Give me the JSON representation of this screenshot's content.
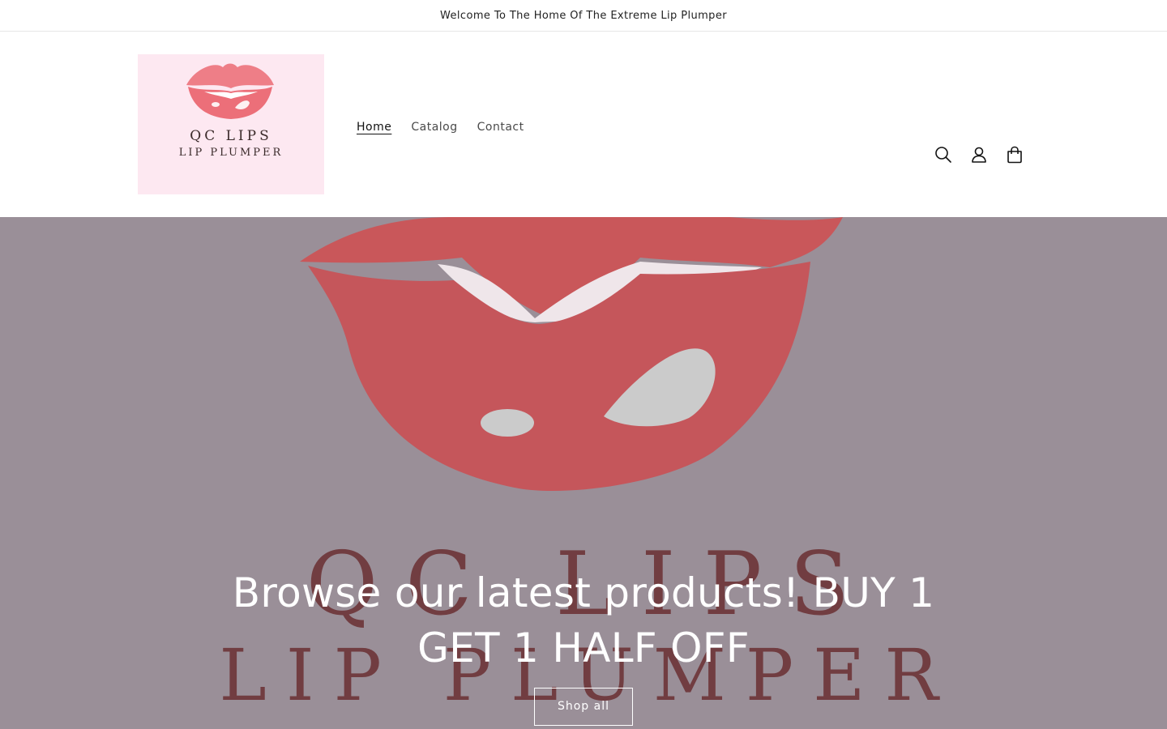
{
  "announcement": {
    "text": "Welcome To The Home Of The Extreme Lip Plumper"
  },
  "header": {
    "logo": {
      "line1": "QC LIPS",
      "line2": "LIP PLUMPER"
    },
    "nav": [
      {
        "label": "Home",
        "active": true
      },
      {
        "label": "Catalog",
        "active": false
      },
      {
        "label": "Contact",
        "active": false
      }
    ],
    "icons": [
      "search-icon",
      "account-icon",
      "cart-icon"
    ]
  },
  "hero": {
    "heading": "Browse our latest products! BUY 1 GET 1 HALF OFF",
    "button_label": "Shop all",
    "art_line1": "QC LIPS",
    "art_line2": "LIP PLUMPER"
  },
  "colors": {
    "hero_bg": "#9a8f98",
    "lip_red": "#c9575a",
    "logo_bg": "#fde8f1",
    "text_dark": "#121212"
  }
}
